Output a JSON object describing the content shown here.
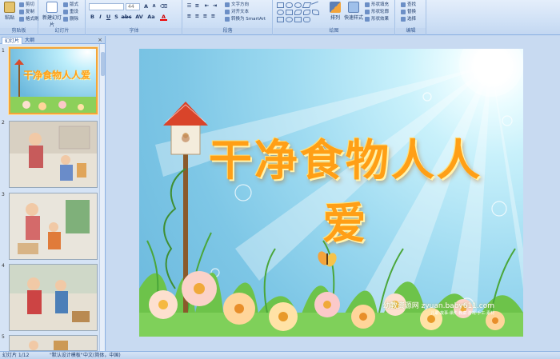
{
  "ribbon": {
    "clipboard": {
      "paste": "粘贴",
      "cut": "剪切",
      "copy": "复制",
      "format_painter": "格式刷",
      "label": "剪贴板"
    },
    "slides": {
      "new_slide": "新建幻灯片",
      "layout": "版式",
      "reset": "重设",
      "delete": "删除",
      "label": "幻灯片"
    },
    "font": {
      "font_size": "44",
      "bold": "B",
      "italic": "I",
      "underline": "U",
      "shadow": "S",
      "strike": "abc",
      "spacing": "AV",
      "case": "Aa",
      "color": "A",
      "label": "字体"
    },
    "paragraph": {
      "text_direction": "文字方向",
      "align_text": "对齐文本",
      "smartart": "转换为 SmartArt",
      "label": "段落"
    },
    "drawing": {
      "arrange": "排列",
      "quick_styles": "快速样式",
      "shape_fill": "形状填充",
      "shape_outline": "形状轮廓",
      "shape_effects": "形状效果",
      "label": "绘图"
    },
    "editing": {
      "find": "查找",
      "replace": "替换",
      "select": "选择",
      "label": "编辑"
    }
  },
  "panel": {
    "tabs": [
      "幻灯片",
      "大纲"
    ],
    "close": "×",
    "thumbnails": [
      {
        "num": "1",
        "title": "干净食物人人爱"
      },
      {
        "num": "2"
      },
      {
        "num": "3"
      },
      {
        "num": "4"
      },
      {
        "num": "5"
      }
    ]
  },
  "slide": {
    "title": "干净食物人人爱",
    "watermark": "幼教资源网 zyuan.baby611.com",
    "watermark_sub": "儿歌·故事·课件·教案·游戏·手工·素材"
  },
  "status": {
    "slide_count": "幻灯片 1/12",
    "theme": "\"默认设计模板\"",
    "language": "中文(简体，中国)"
  },
  "colors": {
    "accent": "#ff9f16",
    "ribbon": "#cddff5",
    "selection": "#f3a43a"
  }
}
